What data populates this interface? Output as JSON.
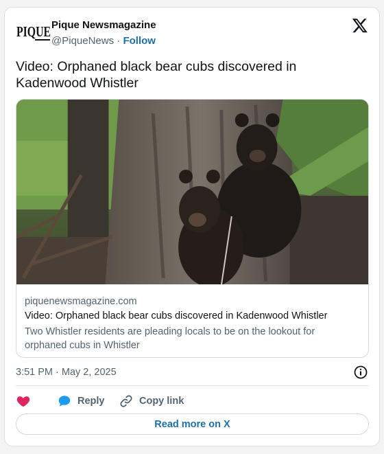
{
  "author": {
    "logo_text": "PIQUE",
    "name": "Pique Newsmagazine",
    "handle": "@PiqueNews",
    "separator": "·",
    "follow_label": "Follow"
  },
  "tweet": {
    "text": "Video: Orphaned black bear cubs discovered in Kadenwood Whistler"
  },
  "link_card": {
    "domain": "piquenewsmagazine.com",
    "title": "Video: Orphaned black bear cubs discovered in Kadenwood Whistler",
    "description": "Two Whistler residents are pleading locals to be on the lookout for orphaned cubs in Whistler"
  },
  "meta": {
    "timestamp": "3:51 PM · May 2, 2025"
  },
  "actions": {
    "reply_label": "Reply",
    "copy_link_label": "Copy link"
  },
  "footer": {
    "read_more_label": "Read more on X"
  },
  "colors": {
    "accent": "#1d6fa8",
    "heart": "#e0245e",
    "reply": "#1d9bf0",
    "text": "#0f1419",
    "muted": "#536471"
  }
}
